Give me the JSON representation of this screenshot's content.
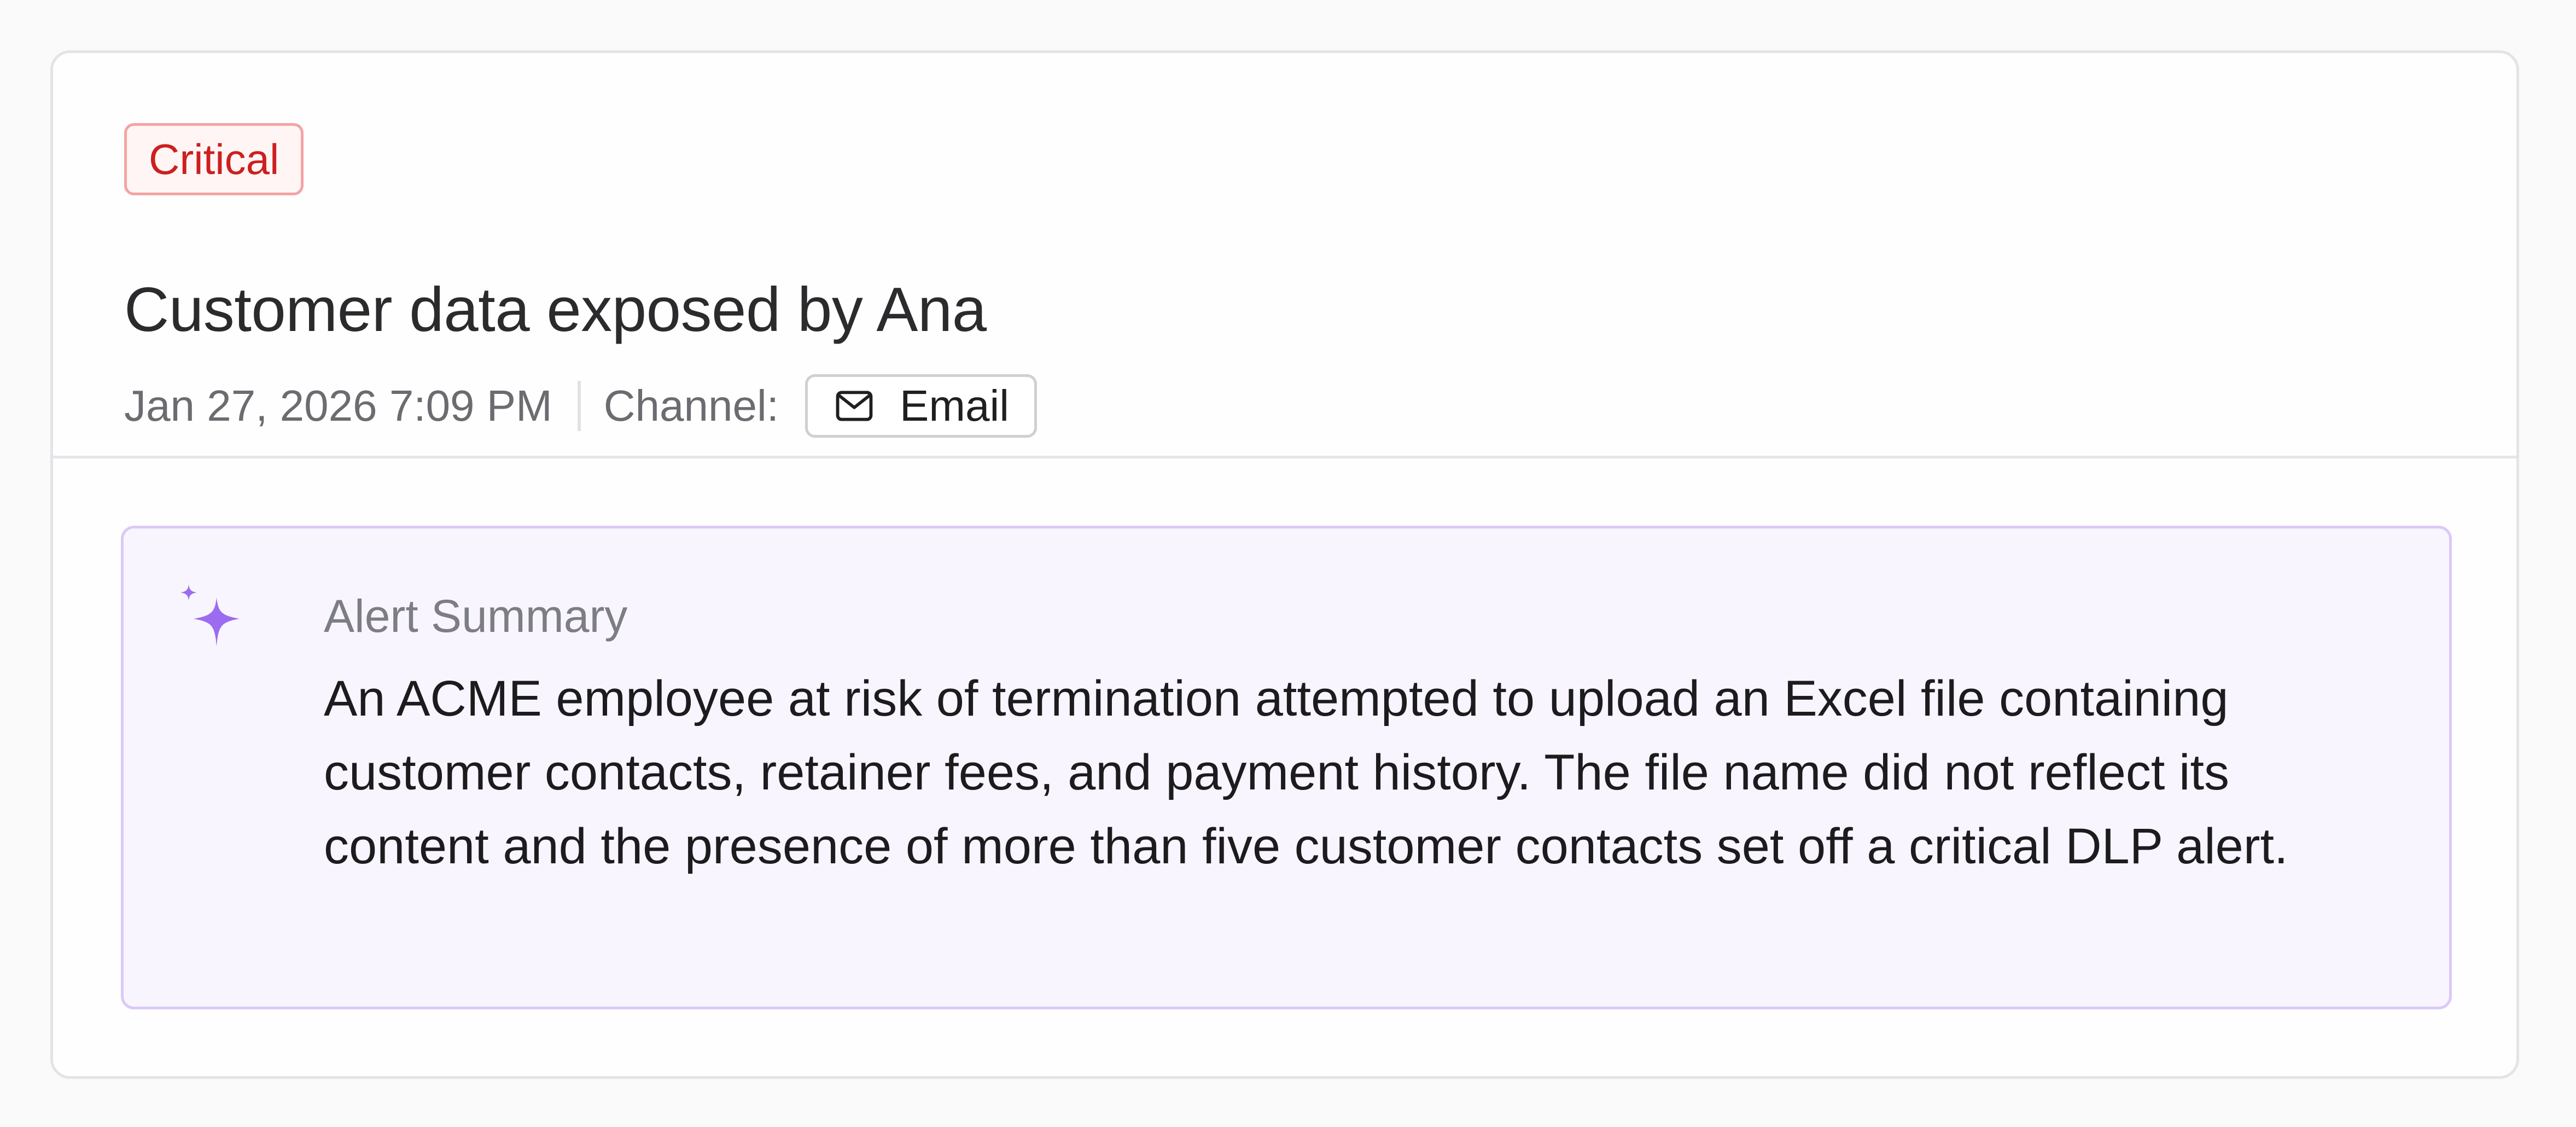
{
  "alert": {
    "severity": "Critical",
    "title": "Customer data exposed by Ana",
    "timestamp": "Jan 27, 2026 7:09 PM",
    "channel_label": "Channel:",
    "channel_value": "Email",
    "channel_icon": "mail-icon"
  },
  "summary": {
    "icon": "sparkle-icon",
    "title": "Alert Summary",
    "text": "An ACME employee at risk of termination attempted to upload an Excel file containing customer contacts, retainer fees, and payment history. The file name did not reflect its content and the presence of more than five customer contacts set off a critical DLP alert."
  },
  "colors": {
    "severity_text": "#cc1f1f",
    "severity_border": "#f5a3a3",
    "summary_bg": "#f8f5fe",
    "summary_border": "#dcc9f7",
    "sparkle": "#9b6cf0"
  }
}
